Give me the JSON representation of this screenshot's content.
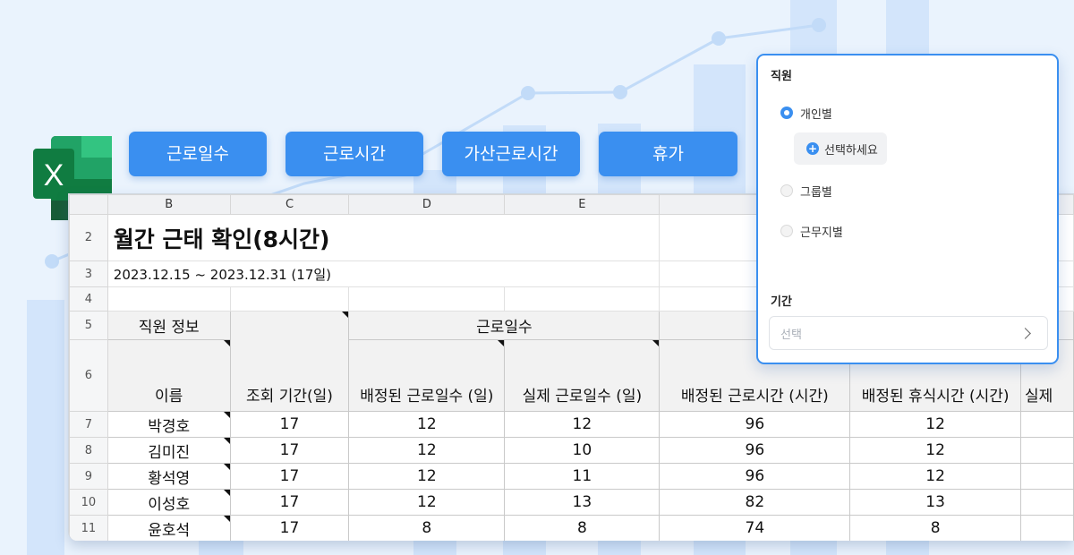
{
  "tabs": [
    {
      "label": "근로일수"
    },
    {
      "label": "근로시간"
    },
    {
      "label": "가산근로시간"
    },
    {
      "label": "휴가"
    }
  ],
  "colors": {
    "accent": "#3a8ff0",
    "excel_green": "#21a366",
    "excel_dark": "#107c41",
    "background": "#eaf3fd"
  },
  "excel_logo": {
    "letter": "X"
  },
  "sheet": {
    "columns": [
      "B",
      "C",
      "D",
      "E"
    ],
    "title": "월간 근태 확인(8시간)",
    "date_range": "2023.12.15 ~ 2023.12.31 (17일)",
    "group_headers": {
      "employee_info": "직원 정보",
      "work_days": "근로일수"
    },
    "headers": {
      "name": "이름",
      "period": "조회 기간(일)",
      "assigned_days": "배정된 근로일수 (일)",
      "actual_days": "실제 근로일수 (일)",
      "assigned_hours": "배정된 근로시간 (시간)",
      "assigned_rest": "배정된 휴식시간 (시간)",
      "cut_col": "실제"
    },
    "header_row_numbers": [
      "2",
      "3",
      "4",
      "5",
      "6"
    ],
    "rows": [
      {
        "row": "7",
        "name": "박경호",
        "period": "17",
        "assigned_days": "12",
        "actual_days": "12",
        "assigned_hours": "96",
        "assigned_rest": "12"
      },
      {
        "row": "8",
        "name": "김미진",
        "period": "17",
        "assigned_days": "12",
        "actual_days": "10",
        "assigned_hours": "96",
        "assigned_rest": "12"
      },
      {
        "row": "9",
        "name": "황석영",
        "period": "17",
        "assigned_days": "12",
        "actual_days": "11",
        "assigned_hours": "96",
        "assigned_rest": "12"
      },
      {
        "row": "10",
        "name": "이성호",
        "period": "17",
        "assigned_days": "12",
        "actual_days": "13",
        "assigned_hours": "82",
        "assigned_rest": "13"
      },
      {
        "row": "11",
        "name": "윤호석",
        "period": "17",
        "assigned_days": "8",
        "actual_days": "8",
        "assigned_hours": "74",
        "assigned_rest": "8"
      }
    ]
  },
  "filter_panel": {
    "employee_label": "직원",
    "options": [
      {
        "label": "개인별",
        "selected": true
      },
      {
        "label": "그룹별",
        "selected": false
      },
      {
        "label": "근무지별",
        "selected": false
      }
    ],
    "select_person_label": "선택하세요",
    "period_label": "기간",
    "period_placeholder": "선택"
  }
}
